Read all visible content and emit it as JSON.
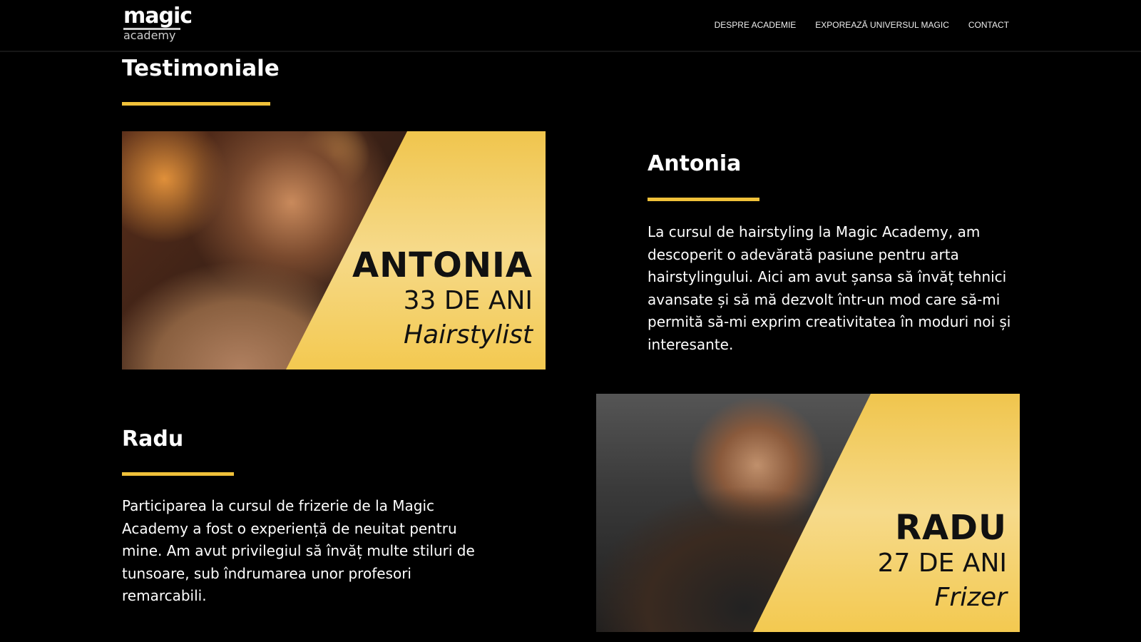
{
  "header": {
    "logo_top": "magic",
    "logo_bottom": "academy",
    "nav": [
      "DESPRE ACADEMIE",
      "EXPOREAZĂ UNIVERSUL MAGIC",
      "CONTACT"
    ]
  },
  "section_title": "Testimoniale",
  "accent_color": "#f0c13a",
  "testimonials": [
    {
      "name": "Antonia",
      "card_name": "ANTONIA",
      "age": "33 DE ANI",
      "role": "Hairstylist",
      "text": "La cursul de hairstyling la Magic Academy, am descoperit o adevărată pasiune pentru arta hairstylingului. Aici am avut șansa să învăț tehnici avansate și să mă dezvolt într-un mod care să-mi permită să-mi exprim creativitatea în moduri noi și interesante."
    },
    {
      "name": "Radu",
      "card_name": "RADU",
      "age": "27 DE ANI",
      "role": "Frizer",
      "text": "Participarea la cursul de frizerie de la Magic Academy a fost o experiență de neuitat pentru mine. Am avut privilegiul să învăț multe stiluri de tunsoare, sub îndrumarea unor profesori remarcabili."
    }
  ]
}
